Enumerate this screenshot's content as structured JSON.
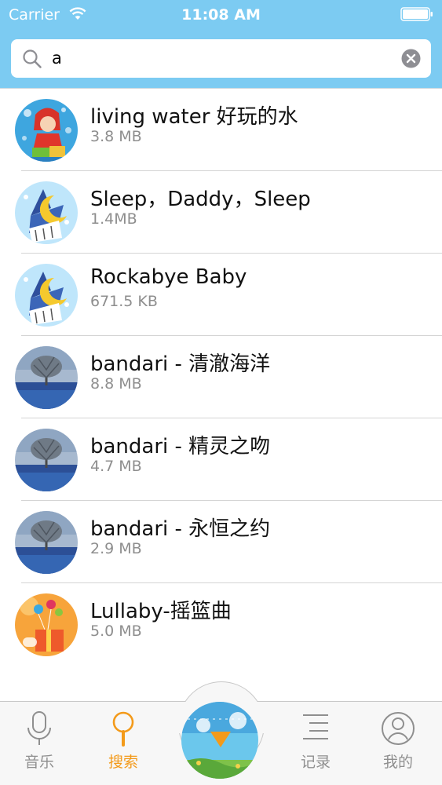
{
  "status_bar": {
    "carrier": "Carrier",
    "time": "11:08 AM",
    "wifi_icon": "wifi-icon",
    "battery_icon": "battery-full-icon"
  },
  "search": {
    "value": "a",
    "search_icon": "magnifier-icon",
    "clear_icon": "clear-circle-x-icon"
  },
  "results": [
    {
      "title": "living water 好玩的水",
      "size": "3.8 MB",
      "artwork": "girl-cartoon"
    },
    {
      "title": "Sleep，Daddy，Sleep",
      "size": "1.4MB",
      "artwork": "moon-bird"
    },
    {
      "title": "Rockabye Baby",
      "size": "671.5 KB",
      "artwork": "moon-bird"
    },
    {
      "title": "bandari - 清澈海洋",
      "size": "8.8 MB",
      "artwork": "tree-landscape"
    },
    {
      "title": "bandari - 精灵之吻",
      "size": "4.7 MB",
      "artwork": "tree-landscape"
    },
    {
      "title": "bandari - 永恒之约",
      "size": "2.9 MB",
      "artwork": "tree-landscape"
    },
    {
      "title": "Lullaby-摇篮曲",
      "size": "5.0 MB",
      "artwork": "gift-balloons"
    }
  ],
  "tabs": [
    {
      "label": "音乐",
      "icon": "microphone-icon",
      "active": false
    },
    {
      "label": "搜索",
      "icon": "search-tab-icon",
      "active": true
    },
    {
      "label": "记录",
      "icon": "list-icon",
      "active": false
    },
    {
      "label": "我的",
      "icon": "user-icon",
      "active": false
    }
  ],
  "now_playing": {
    "icon": "play-icon"
  },
  "colors": {
    "header": "#7ccbf2",
    "accent": "#f39a1a",
    "tab_inactive": "#8f8f8f",
    "secondary_text": "#8e8e8e"
  }
}
